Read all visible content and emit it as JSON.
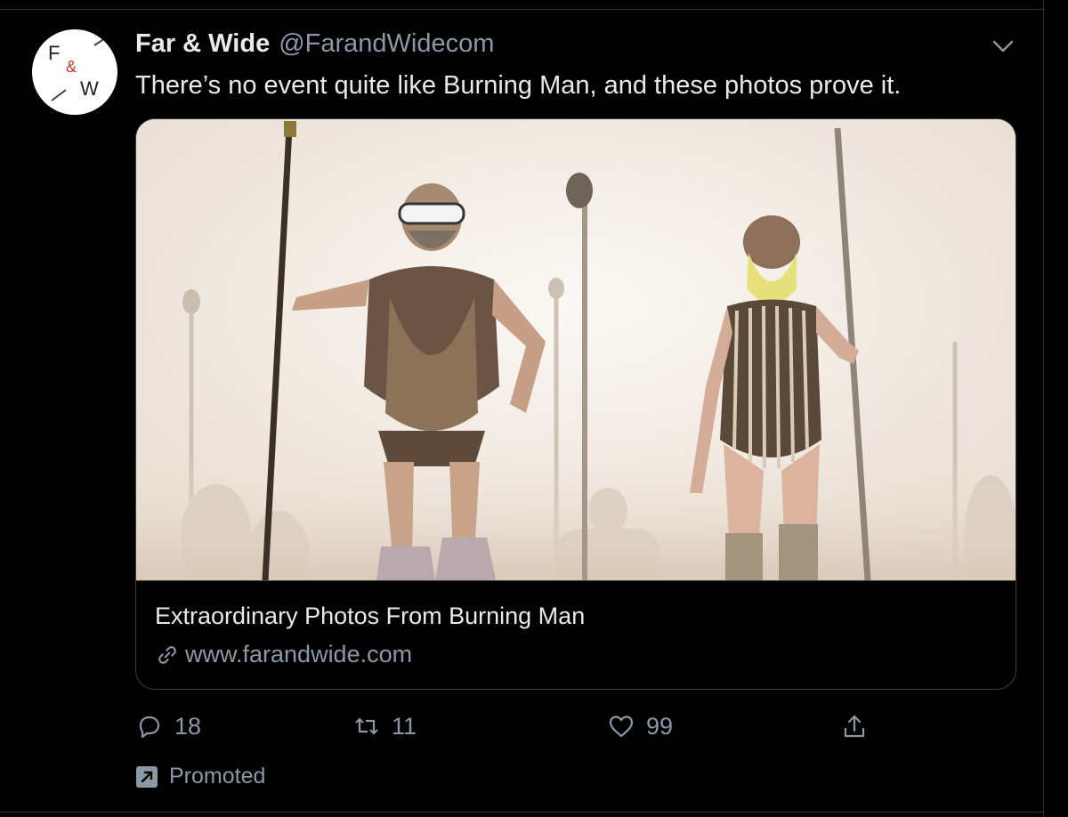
{
  "tweet": {
    "display_name": "Far & Wide",
    "handle": "@FarandWidecom",
    "text": "There’s no event quite like Burning Man, and these photos prove it.",
    "avatar": {
      "letters": [
        "F",
        "&",
        "W"
      ],
      "accent": "#c0392b"
    }
  },
  "card": {
    "title": "Extraordinary Photos From Burning Man",
    "domain": "www.farandwide.com"
  },
  "actions": {
    "reply_count": "18",
    "retweet_count": "11",
    "like_count": "99"
  },
  "promoted_label": "Promoted",
  "icons": [
    "chevron-down-icon",
    "link-icon",
    "reply-icon",
    "retweet-icon",
    "like-icon",
    "share-icon",
    "promoted-icon"
  ],
  "colors": {
    "background": "#000000",
    "text": "#e7e9ea",
    "secondary_text": "#8b98a5",
    "border": "#2f3336"
  }
}
